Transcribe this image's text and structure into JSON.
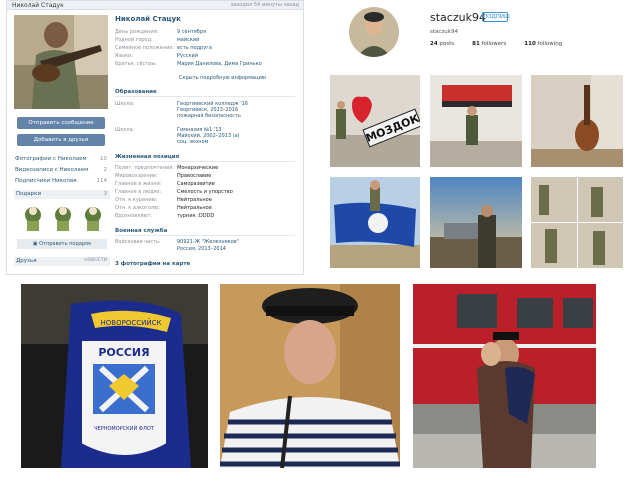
{
  "vk": {
    "header_name": "Николай Стадук",
    "header_status": "заходил 54 минуты назад",
    "profile_name": "Николай Стацук",
    "actions": {
      "send_message": "Отправить сообщение",
      "add_friend": "Добавить в друзья"
    },
    "counters": [
      {
        "label": "Фотографии с Николаем",
        "count": "10"
      },
      {
        "label": "Видеозаписи с Николаем",
        "count": "2"
      },
      {
        "label": "Подписчики Николая",
        "count": "114"
      }
    ],
    "gifts": {
      "title": "Подарки",
      "count": "3",
      "send_label": "Отправить подарок"
    },
    "friends": {
      "title": "Друзья",
      "link": "НОВОСТИ"
    },
    "basic": [
      {
        "label": "День рождения:",
        "value": "9 сентября"
      },
      {
        "label": "Родной город:",
        "value": "майский"
      },
      {
        "label": "Семейное положение:",
        "value": "есть подруга"
      },
      {
        "label": "Языки:",
        "value": "Русский"
      },
      {
        "label": "Братья, сёстры:",
        "value": "Мария Данилова, Дима Гринько"
      }
    ],
    "show_more": "Скрыть подробную информацию",
    "education": {
      "title": "Образование",
      "school1_label": "Школа:",
      "school1_lines": [
        "Георгиевский колледж '16",
        "Георгиевск, 2013–2016",
        "пожарная безопасность"
      ],
      "school2_label": "Школа:",
      "school2_lines": [
        "Гимназия №1 '13",
        "Майский, 2002–2013 (а)",
        "соц. эконом"
      ]
    },
    "position": {
      "title": "Жизненная позиция",
      "rows": [
        {
          "label": "Полит. предпочтения:",
          "value": "Монархические"
        },
        {
          "label": "Мировоззрение:",
          "value": "Православие"
        },
        {
          "label": "Главное в жизни:",
          "value": "Саморазвитие"
        },
        {
          "label": "Главное в людях:",
          "value": "Смелость и упорство"
        },
        {
          "label": "Отн. к курению:",
          "value": "Нейтральное"
        },
        {
          "label": "Отн. к алкоголю:",
          "value": "Нейтральное"
        },
        {
          "label": "Вдохновляют:",
          "value": "турник :DDDD"
        }
      ]
    },
    "military": {
      "title": "Военная служба",
      "label": "Войсковая часть:",
      "lines": [
        "90921-Ж \"Железняков\"",
        "Россия, 2013–2014"
      ]
    },
    "map_title": "3 фотографии на карте"
  },
  "instagram": {
    "username": "staczuk94",
    "follow_label": "ПОДПИШ",
    "display_name": "staczuk94",
    "posts": "24",
    "posts_label": "posts",
    "followers": "81",
    "followers_label": "followers",
    "following": "110",
    "following_label": "following",
    "sign_text": "МОЗДОК"
  },
  "patch": {
    "top_text": "НОВОРОССИЙСК",
    "main_text": "РОССИЯ",
    "bottom_text": "ЧЕРНОМОРСКИЙ ФЛОТ"
  },
  "colors": {
    "vk_link": "#2b587a",
    "vk_button": "#6383a8",
    "ig_blue": "#3d8ed2"
  }
}
